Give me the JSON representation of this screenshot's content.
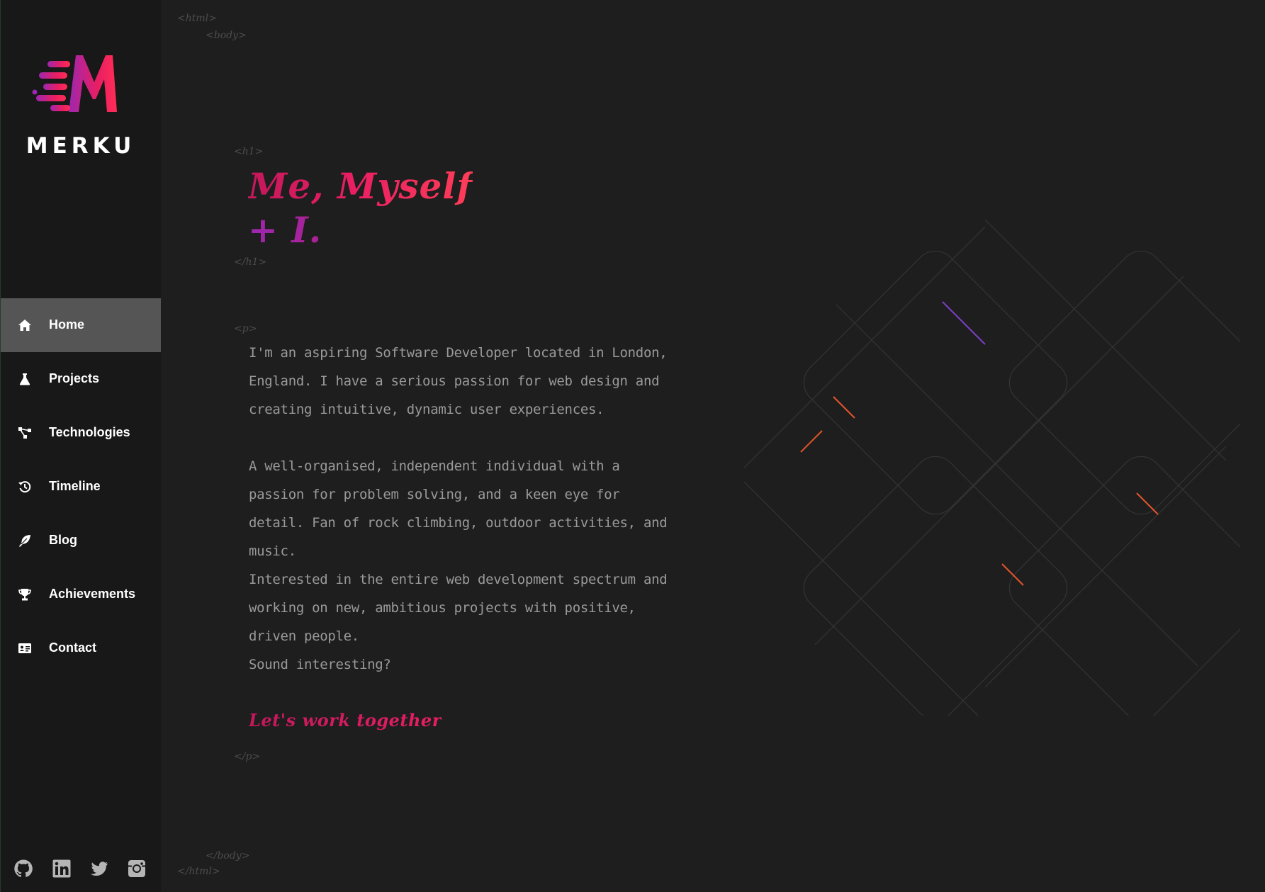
{
  "brand": {
    "name": "MERKU",
    "logo_icon": "merku-m-logo-icon"
  },
  "nav": {
    "items": [
      {
        "label": "Home",
        "icon": "home-icon",
        "active": true
      },
      {
        "label": "Projects",
        "icon": "flask-icon",
        "active": false
      },
      {
        "label": "Technologies",
        "icon": "network-icon",
        "active": false
      },
      {
        "label": "Timeline",
        "icon": "history-icon",
        "active": false
      },
      {
        "label": "Blog",
        "icon": "feather-icon",
        "active": false
      },
      {
        "label": "Achievements",
        "icon": "trophy-icon",
        "active": false
      },
      {
        "label": "Contact",
        "icon": "id-card-icon",
        "active": false
      }
    ]
  },
  "socials": [
    {
      "icon": "github-icon"
    },
    {
      "icon": "linkedin-icon"
    },
    {
      "icon": "twitter-icon"
    },
    {
      "icon": "instagram-icon"
    }
  ],
  "tags": {
    "html_open": "<html>",
    "body_open": "<body>",
    "h1_open": "<h1>",
    "h1_close": "</h1>",
    "p_open": "<p>",
    "p_close": "</p>",
    "body_close": "</body>",
    "html_close": "</html>"
  },
  "hero": {
    "line1": "Me, Myself",
    "line2": "+ I."
  },
  "about": {
    "para1": "I'm an aspiring Software Developer located in London, England. I have a serious passion for web design and creating intuitive, dynamic user experiences.",
    "para2": "A well-organised, independent individual with a passion for problem solving, and a keen eye for detail. Fan of rock climbing, outdoor activities, and music.",
    "para3": "Interested in the entire web development spectrum and working on new, ambitious projects with positive, driven people.",
    "para4": "Sound interesting?",
    "cta": "Let's work together"
  },
  "colors": {
    "accent_pink": "#e91e63",
    "accent_purple": "#9c27b0",
    "background": "#1e1e1e",
    "sidebar": "#181818",
    "nav_active": "#555555"
  }
}
